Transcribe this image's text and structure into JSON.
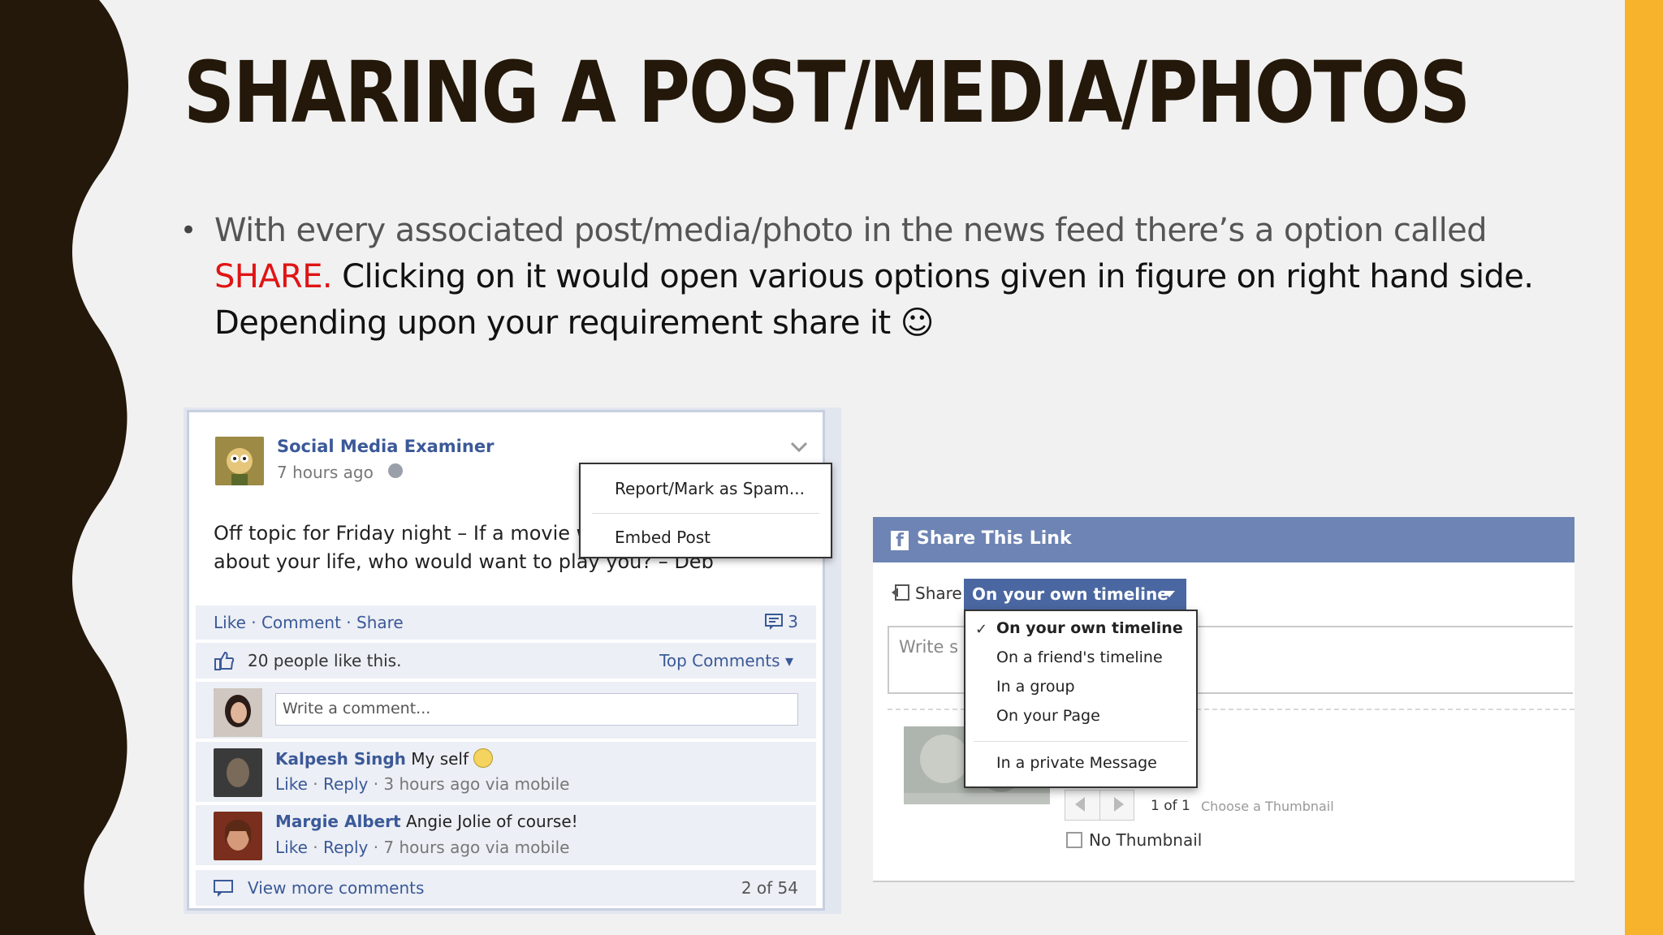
{
  "slide": {
    "title": "SHARING A POST/MEDIA/PHOTOS",
    "bullet": {
      "part1": "With every associated post/media/photo in the news feed there’s a option called",
      "share_word": "SHARE.",
      "part2": " Clicking on it would open various options given in figure on right hand side. Depending upon your requirement share it ☺"
    },
    "colors": {
      "accent_bar": "#f7b32b",
      "wave": "#24180a",
      "highlight": "#e01414"
    }
  },
  "fb_post": {
    "page_name": "Social Media Examiner",
    "time": "7 hours ago",
    "body": "Off topic for Friday night – If a movie was made about your life, who would want to play you? – Deb",
    "menu": {
      "item1": "Report/Mark as Spam...",
      "item2": "Embed Post"
    },
    "actions": "Like · Comment · Share",
    "comment_count": "3",
    "likes": "20 people like this.",
    "top_comments": "Top Comments ▾",
    "write_placeholder": "Write a comment...",
    "comments": [
      {
        "author": "Kalpesh Singh",
        "text": " My self",
        "meta_like": "Like",
        "meta_reply": "Reply",
        "meta_time": " · 3 hours ago via mobile"
      },
      {
        "author": "Margie Albert",
        "text": " Angie Jolie of course!",
        "meta_like": "Like",
        "meta_reply": "Reply",
        "meta_time": " · 7 hours ago via mobile"
      }
    ],
    "view_more": "View more comments",
    "page_count": "2 of 54"
  },
  "share_dialog": {
    "title": "Share This Link",
    "share_label": "Share:",
    "selected": "On your own timeline",
    "write_placeholder": "Write s",
    "options": [
      "On your own timeline",
      "On a friend's timeline",
      "In a group",
      "On your Page",
      "In a private Message"
    ],
    "thumb_index": "1 of 1",
    "choose_thumb": "Choose a Thumbnail",
    "no_thumbnail": "No Thumbnail"
  }
}
